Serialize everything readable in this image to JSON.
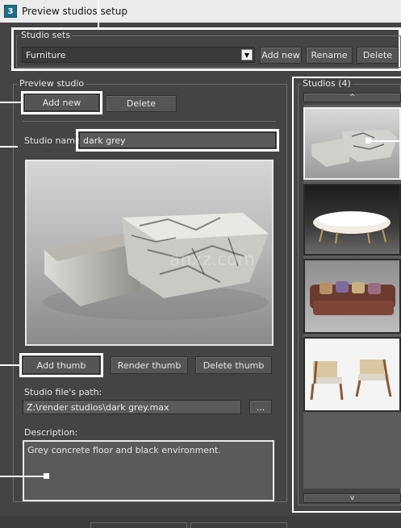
{
  "window": {
    "title": "Preview studios setup",
    "icon": "3ds-max-app-icon"
  },
  "studio_sets": {
    "group_label": "Studio sets",
    "selected": "Furniture",
    "add_new_label": "Add new",
    "rename_label": "Rename",
    "delete_label": "Delete"
  },
  "preview_studio": {
    "group_label": "Preview studio",
    "add_new_label": "Add new",
    "delete_label": "Delete",
    "studio_name_label": "Studio name:",
    "studio_name_value": "dark grey",
    "add_thumb_label": "Add thumb",
    "render_thumb_label": "Render thumb",
    "delete_thumb_label": "Delete thumb",
    "file_path_label": "Studio file's path:",
    "file_path_value": "Z:\\render studios\\dark grey.max",
    "browse_label": "...",
    "description_label": "Description:",
    "description_value": "Grey concrete floor and black environment.",
    "watermark_text": "anxz.com"
  },
  "studios_list": {
    "group_label": "Studios (4)",
    "scroll_up": "^",
    "scroll_down": "v",
    "thumbnails": [
      "marble-table-thumbnail",
      "white-bench-thumbnail",
      "brown-sofa-thumbnail",
      "armchairs-thumbnail"
    ]
  },
  "colors": {
    "background": "#444444",
    "highlight": "#ffffff",
    "button": "#555555",
    "field": "#5a5a5a"
  }
}
